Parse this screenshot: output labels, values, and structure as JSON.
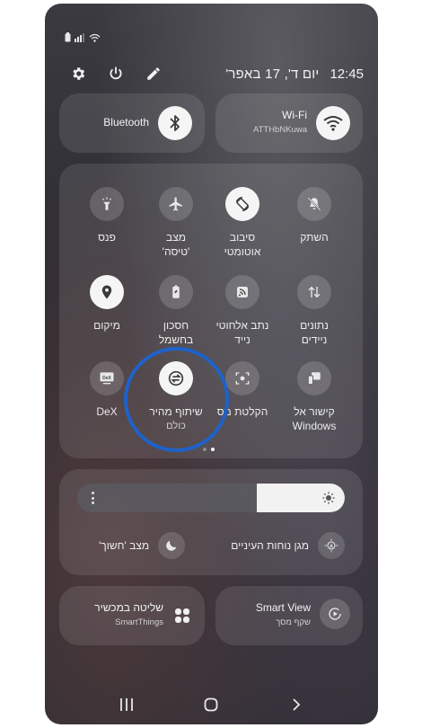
{
  "status": {
    "battery": "▮",
    "signal": "||‧",
    "wifi": "wifi"
  },
  "header": {
    "date": "יום ד', 17 באפר'",
    "time": "12:45"
  },
  "big_tiles": {
    "wifi": {
      "title": "Wi-Fi",
      "sub": "ATTHbNKuwa"
    },
    "bluetooth": {
      "title": "Bluetooth"
    }
  },
  "tiles": [
    {
      "label": "השתק"
    },
    {
      "label": "סיבוב\nאוטומטי"
    },
    {
      "label": "מצב\n'טיסה'"
    },
    {
      "label": "פנס"
    },
    {
      "label": "נתונים\nניידים"
    },
    {
      "label": "נתב אלחוטי\nנייד"
    },
    {
      "label": "חסכון\nבחשמל"
    },
    {
      "label": "מיקום"
    },
    {
      "label": "קישור אל\nWindows"
    },
    {
      "label": "הקלטת מס"
    },
    {
      "label": "שיתוף מהיר",
      "sub": "כולם"
    },
    {
      "label": "DeX"
    }
  ],
  "brightness": {
    "level": 0.33
  },
  "options": {
    "eye_comfort": "מגן נוחות העיניים",
    "dark_mode": "מצב 'חשוך'"
  },
  "bottom_tiles": {
    "smart_view": {
      "title": "Smart View",
      "sub": "שקף מסך"
    },
    "device_control": {
      "title": "שליטה במכשיר",
      "sub": "SmartThings"
    }
  },
  "colors": {
    "highlight_ring": "#1e62c9",
    "tile_bg": "rgba(255,255,255,0.10)",
    "active_button": "#f5f5f5"
  }
}
